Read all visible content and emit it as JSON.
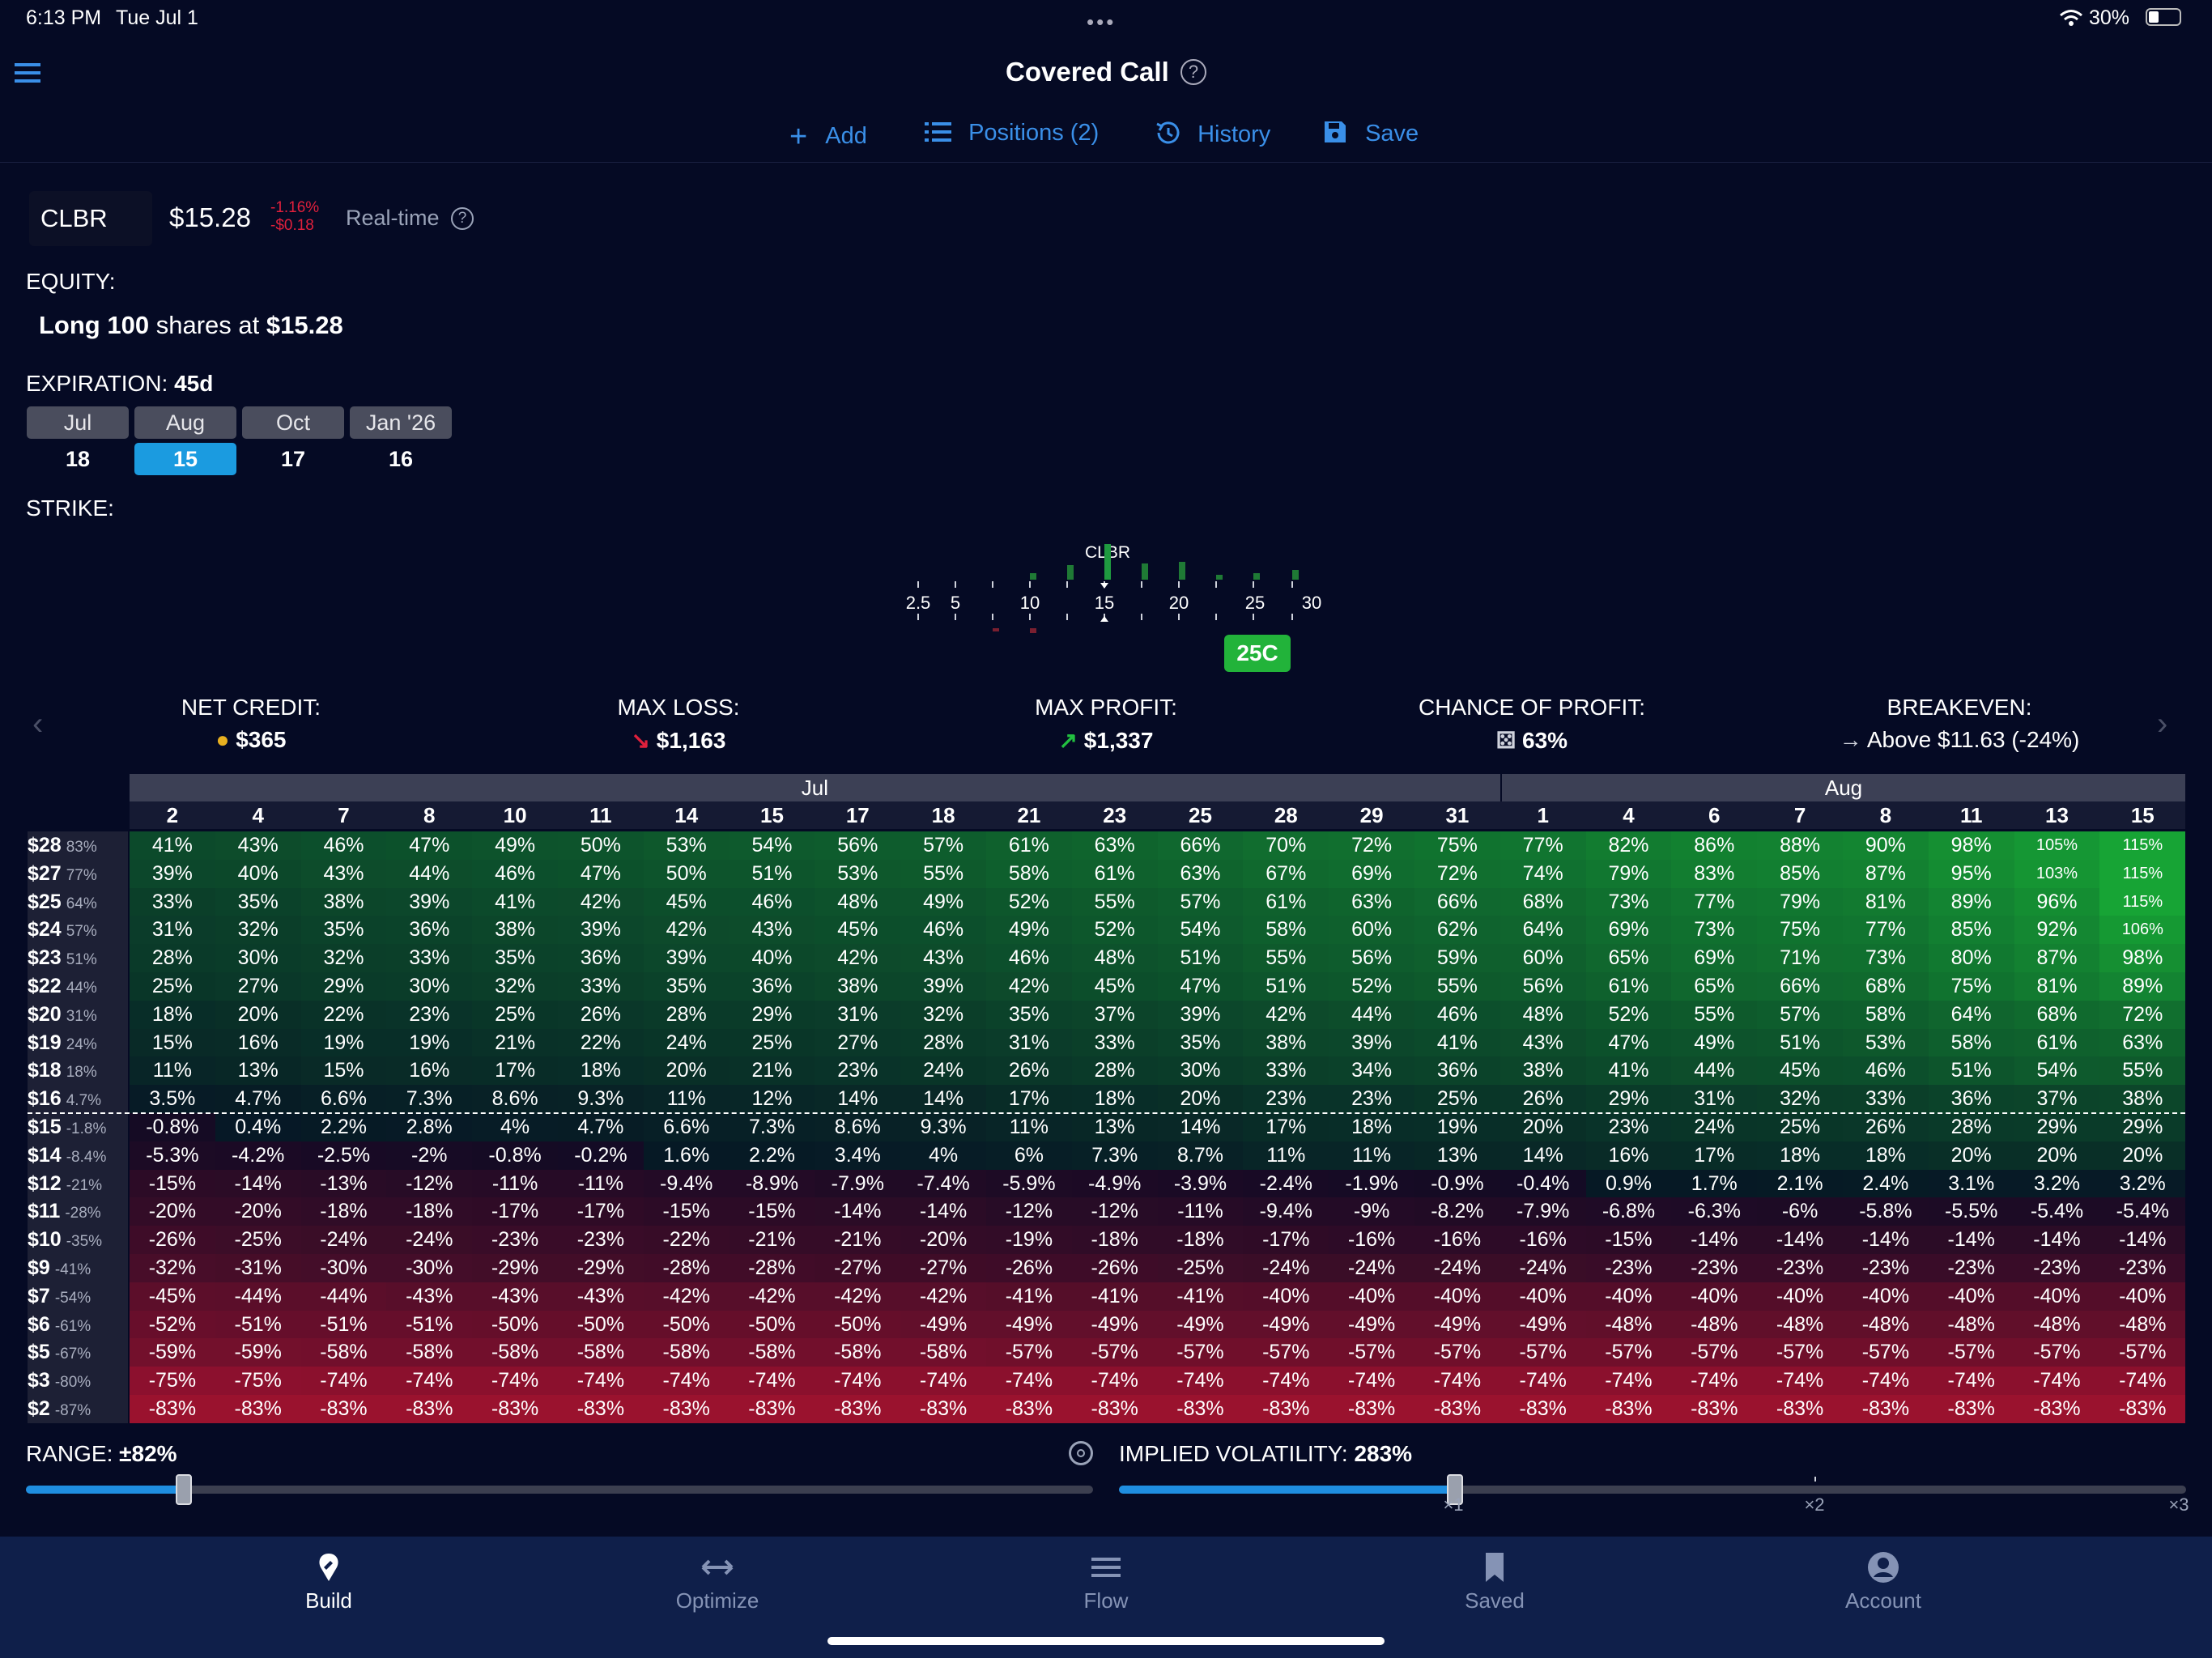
{
  "status": {
    "time": "6:13 PM",
    "date": "Tue Jul 1",
    "battery": "30%"
  },
  "header": {
    "title": "Covered Call"
  },
  "toolbar": {
    "add": "Add",
    "positions": "Positions (2)",
    "history": "History",
    "save": "Save"
  },
  "quote": {
    "symbol": "CLBR",
    "price": "$15.28",
    "change_pct": "-1.16%",
    "change_abs": "-$0.18",
    "realtime": "Real-time"
  },
  "equity": {
    "label": "EQUITY:",
    "desc_prefix": "Long",
    "qty": "100",
    "desc_mid": "shares at",
    "price": "$15.28"
  },
  "expiration": {
    "label": "EXPIRATION:",
    "days": "45d",
    "months": [
      "Jul",
      "Aug",
      "Oct",
      "Jan '26"
    ],
    "dates": [
      "18",
      "15",
      "17",
      "16"
    ],
    "selected_index": 1
  },
  "strike": {
    "label": "STRIKE:",
    "ticker": "CLBR",
    "ticks": [
      "2.5",
      "5",
      "10",
      "15",
      "20",
      "25",
      "30"
    ],
    "selected": "25C"
  },
  "metrics": {
    "net_credit": {
      "title": "NET CREDIT:",
      "value": "$365"
    },
    "max_loss": {
      "title": "MAX LOSS:",
      "value": "$1,163"
    },
    "max_profit": {
      "title": "MAX PROFIT:",
      "value": "$1,337"
    },
    "chance": {
      "title": "CHANCE OF PROFIT:",
      "value": "63%"
    },
    "breakeven": {
      "title": "BREAKEVEN:",
      "value": "Above $11.63 (-24%)"
    }
  },
  "table": {
    "months": [
      {
        "name": "Jul",
        "span": 16
      },
      {
        "name": "Aug",
        "span": 8
      }
    ],
    "days": [
      "2",
      "4",
      "7",
      "8",
      "10",
      "11",
      "14",
      "15",
      "17",
      "18",
      "21",
      "23",
      "25",
      "28",
      "29",
      "31",
      "1",
      "4",
      "6",
      "7",
      "8",
      "11",
      "13",
      "15"
    ],
    "rows": [
      {
        "price": "$28",
        "pct": "83%",
        "vals": [
          "41%",
          "43%",
          "46%",
          "47%",
          "49%",
          "50%",
          "53%",
          "54%",
          "56%",
          "57%",
          "61%",
          "63%",
          "66%",
          "70%",
          "72%",
          "75%",
          "77%",
          "82%",
          "86%",
          "88%",
          "90%",
          "98%",
          "105%",
          "115%"
        ]
      },
      {
        "price": "$27",
        "pct": "77%",
        "vals": [
          "39%",
          "40%",
          "43%",
          "44%",
          "46%",
          "47%",
          "50%",
          "51%",
          "53%",
          "55%",
          "58%",
          "61%",
          "63%",
          "67%",
          "69%",
          "72%",
          "74%",
          "79%",
          "83%",
          "85%",
          "87%",
          "95%",
          "103%",
          "115%"
        ]
      },
      {
        "price": "$25",
        "pct": "64%",
        "vals": [
          "33%",
          "35%",
          "38%",
          "39%",
          "41%",
          "42%",
          "45%",
          "46%",
          "48%",
          "49%",
          "52%",
          "55%",
          "57%",
          "61%",
          "63%",
          "66%",
          "68%",
          "73%",
          "77%",
          "79%",
          "81%",
          "89%",
          "96%",
          "115%"
        ]
      },
      {
        "price": "$24",
        "pct": "57%",
        "vals": [
          "31%",
          "32%",
          "35%",
          "36%",
          "38%",
          "39%",
          "42%",
          "43%",
          "45%",
          "46%",
          "49%",
          "52%",
          "54%",
          "58%",
          "60%",
          "62%",
          "64%",
          "69%",
          "73%",
          "75%",
          "77%",
          "85%",
          "92%",
          "106%"
        ]
      },
      {
        "price": "$23",
        "pct": "51%",
        "vals": [
          "28%",
          "30%",
          "32%",
          "33%",
          "35%",
          "36%",
          "39%",
          "40%",
          "42%",
          "43%",
          "46%",
          "48%",
          "51%",
          "55%",
          "56%",
          "59%",
          "60%",
          "65%",
          "69%",
          "71%",
          "73%",
          "80%",
          "87%",
          "98%"
        ]
      },
      {
        "price": "$22",
        "pct": "44%",
        "vals": [
          "25%",
          "27%",
          "29%",
          "30%",
          "32%",
          "33%",
          "35%",
          "36%",
          "38%",
          "39%",
          "42%",
          "45%",
          "47%",
          "51%",
          "52%",
          "55%",
          "56%",
          "61%",
          "65%",
          "66%",
          "68%",
          "75%",
          "81%",
          "89%"
        ]
      },
      {
        "price": "$20",
        "pct": "31%",
        "vals": [
          "18%",
          "20%",
          "22%",
          "23%",
          "25%",
          "26%",
          "28%",
          "29%",
          "31%",
          "32%",
          "35%",
          "37%",
          "39%",
          "42%",
          "44%",
          "46%",
          "48%",
          "52%",
          "55%",
          "57%",
          "58%",
          "64%",
          "68%",
          "72%"
        ]
      },
      {
        "price": "$19",
        "pct": "24%",
        "vals": [
          "15%",
          "16%",
          "19%",
          "19%",
          "21%",
          "22%",
          "24%",
          "25%",
          "27%",
          "28%",
          "31%",
          "33%",
          "35%",
          "38%",
          "39%",
          "41%",
          "43%",
          "47%",
          "49%",
          "51%",
          "53%",
          "58%",
          "61%",
          "63%"
        ]
      },
      {
        "price": "$18",
        "pct": "18%",
        "vals": [
          "11%",
          "13%",
          "15%",
          "16%",
          "17%",
          "18%",
          "20%",
          "21%",
          "23%",
          "24%",
          "26%",
          "28%",
          "30%",
          "33%",
          "34%",
          "36%",
          "38%",
          "41%",
          "44%",
          "45%",
          "46%",
          "51%",
          "54%",
          "55%"
        ]
      },
      {
        "price": "$16",
        "pct": "4.7%",
        "vals": [
          "3.5%",
          "4.7%",
          "6.6%",
          "7.3%",
          "8.6%",
          "9.3%",
          "11%",
          "12%",
          "14%",
          "14%",
          "17%",
          "18%",
          "20%",
          "23%",
          "23%",
          "25%",
          "26%",
          "29%",
          "31%",
          "32%",
          "33%",
          "36%",
          "37%",
          "38%"
        ]
      },
      {
        "price": "$15",
        "pct": "-1.8%",
        "vals": [
          "-0.8%",
          "0.4%",
          "2.2%",
          "2.8%",
          "4%",
          "4.7%",
          "6.6%",
          "7.3%",
          "8.6%",
          "9.3%",
          "11%",
          "13%",
          "14%",
          "17%",
          "18%",
          "19%",
          "20%",
          "23%",
          "24%",
          "25%",
          "26%",
          "28%",
          "29%",
          "29%"
        ]
      },
      {
        "price": "$14",
        "pct": "-8.4%",
        "vals": [
          "-5.3%",
          "-4.2%",
          "-2.5%",
          "-2%",
          "-0.8%",
          "-0.2%",
          "1.6%",
          "2.2%",
          "3.4%",
          "4%",
          "6%",
          "7.3%",
          "8.7%",
          "11%",
          "11%",
          "13%",
          "14%",
          "16%",
          "17%",
          "18%",
          "18%",
          "20%",
          "20%",
          "20%"
        ]
      },
      {
        "price": "$12",
        "pct": "-21%",
        "vals": [
          "-15%",
          "-14%",
          "-13%",
          "-12%",
          "-11%",
          "-11%",
          "-9.4%",
          "-8.9%",
          "-7.9%",
          "-7.4%",
          "-5.9%",
          "-4.9%",
          "-3.9%",
          "-2.4%",
          "-1.9%",
          "-0.9%",
          "-0.4%",
          "0.9%",
          "1.7%",
          "2.1%",
          "2.4%",
          "3.1%",
          "3.2%",
          "3.2%"
        ]
      },
      {
        "price": "$11",
        "pct": "-28%",
        "vals": [
          "-20%",
          "-20%",
          "-18%",
          "-18%",
          "-17%",
          "-17%",
          "-15%",
          "-15%",
          "-14%",
          "-14%",
          "-12%",
          "-12%",
          "-11%",
          "-9.4%",
          "-9%",
          "-8.2%",
          "-7.9%",
          "-6.8%",
          "-6.3%",
          "-6%",
          "-5.8%",
          "-5.5%",
          "-5.4%",
          "-5.4%"
        ]
      },
      {
        "price": "$10",
        "pct": "-35%",
        "vals": [
          "-26%",
          "-25%",
          "-24%",
          "-24%",
          "-23%",
          "-23%",
          "-22%",
          "-21%",
          "-21%",
          "-20%",
          "-19%",
          "-18%",
          "-18%",
          "-17%",
          "-16%",
          "-16%",
          "-16%",
          "-15%",
          "-14%",
          "-14%",
          "-14%",
          "-14%",
          "-14%",
          "-14%"
        ]
      },
      {
        "price": "$9",
        "pct": "-41%",
        "vals": [
          "-32%",
          "-31%",
          "-30%",
          "-30%",
          "-29%",
          "-29%",
          "-28%",
          "-28%",
          "-27%",
          "-27%",
          "-26%",
          "-26%",
          "-25%",
          "-24%",
          "-24%",
          "-24%",
          "-24%",
          "-23%",
          "-23%",
          "-23%",
          "-23%",
          "-23%",
          "-23%",
          "-23%"
        ]
      },
      {
        "price": "$7",
        "pct": "-54%",
        "vals": [
          "-45%",
          "-44%",
          "-44%",
          "-43%",
          "-43%",
          "-43%",
          "-42%",
          "-42%",
          "-42%",
          "-42%",
          "-41%",
          "-41%",
          "-41%",
          "-40%",
          "-40%",
          "-40%",
          "-40%",
          "-40%",
          "-40%",
          "-40%",
          "-40%",
          "-40%",
          "-40%",
          "-40%"
        ]
      },
      {
        "price": "$6",
        "pct": "-61%",
        "vals": [
          "-52%",
          "-51%",
          "-51%",
          "-51%",
          "-50%",
          "-50%",
          "-50%",
          "-50%",
          "-50%",
          "-49%",
          "-49%",
          "-49%",
          "-49%",
          "-49%",
          "-49%",
          "-49%",
          "-49%",
          "-48%",
          "-48%",
          "-48%",
          "-48%",
          "-48%",
          "-48%",
          "-48%"
        ]
      },
      {
        "price": "$5",
        "pct": "-67%",
        "vals": [
          "-59%",
          "-59%",
          "-58%",
          "-58%",
          "-58%",
          "-58%",
          "-58%",
          "-58%",
          "-58%",
          "-58%",
          "-57%",
          "-57%",
          "-57%",
          "-57%",
          "-57%",
          "-57%",
          "-57%",
          "-57%",
          "-57%",
          "-57%",
          "-57%",
          "-57%",
          "-57%",
          "-57%"
        ]
      },
      {
        "price": "$3",
        "pct": "-80%",
        "vals": [
          "-75%",
          "-75%",
          "-74%",
          "-74%",
          "-74%",
          "-74%",
          "-74%",
          "-74%",
          "-74%",
          "-74%",
          "-74%",
          "-74%",
          "-74%",
          "-74%",
          "-74%",
          "-74%",
          "-74%",
          "-74%",
          "-74%",
          "-74%",
          "-74%",
          "-74%",
          "-74%",
          "-74%"
        ]
      },
      {
        "price": "$2",
        "pct": "-87%",
        "vals": [
          "-83%",
          "-83%",
          "-83%",
          "-83%",
          "-83%",
          "-83%",
          "-83%",
          "-83%",
          "-83%",
          "-83%",
          "-83%",
          "-83%",
          "-83%",
          "-83%",
          "-83%",
          "-83%",
          "-83%",
          "-83%",
          "-83%",
          "-83%",
          "-83%",
          "-83%",
          "-83%",
          "-83%"
        ]
      }
    ]
  },
  "range": {
    "label": "RANGE:",
    "value": "±82%",
    "level": 0.148
  },
  "iv": {
    "label": "IMPLIED VOLATILITY:",
    "value": "283%",
    "level": 0.315,
    "ticks": [
      "×1",
      "×2",
      "×3"
    ]
  },
  "tabs": [
    "Build",
    "Optimize",
    "Flow",
    "Saved",
    "Account"
  ],
  "colors": {
    "accent": "#3a8fe8",
    "selected": "#1b9be0",
    "profit": "#19a83a",
    "loss": "#b01530"
  }
}
